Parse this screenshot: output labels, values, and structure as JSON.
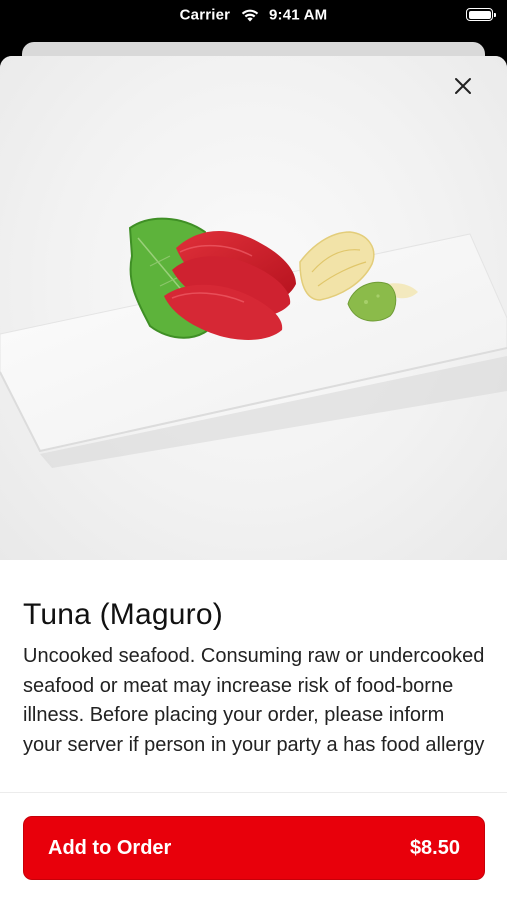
{
  "status_bar": {
    "carrier": "Carrier",
    "time": "9:41 AM",
    "wifi_icon": "wifi-icon",
    "battery_icon": "battery-icon"
  },
  "sheet": {
    "close_icon": "close-icon",
    "photo": "menu-item-photo"
  },
  "item": {
    "title": "Tuna (Maguro)",
    "description": "Uncooked seafood. Consuming raw or undercooked seafood or meat may increase risk of food-borne illness. Before placing your order, please inform your server if person in your party a has food allergy"
  },
  "footer": {
    "add_label": "Add to Order",
    "price": "$8.50",
    "accent_color": "#e8000b"
  }
}
